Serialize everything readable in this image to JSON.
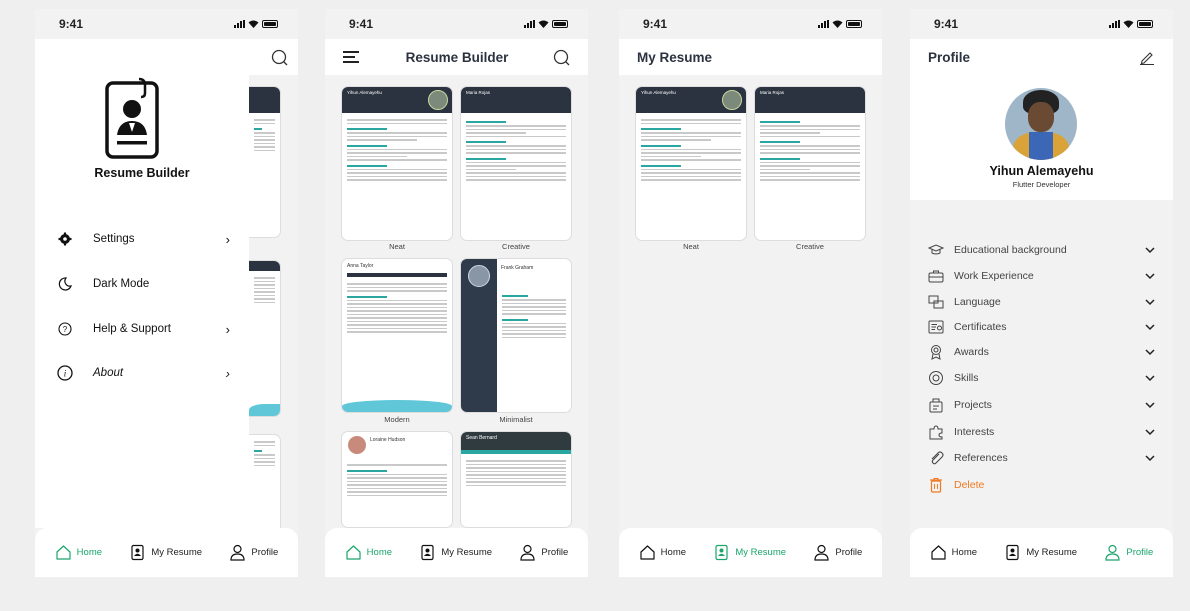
{
  "status": {
    "time": "9:41"
  },
  "colors": {
    "accent": "#1aa56b",
    "delete": "#f07a22",
    "cv_dark": "#2c3340"
  },
  "drawer": {
    "app_title": "Resume Builder",
    "items": [
      {
        "label": "Settings",
        "icon": "gear-icon",
        "has_chevron": true
      },
      {
        "label": "Dark Mode",
        "icon": "moon-icon",
        "has_chevron": false
      },
      {
        "label": "Help & Support",
        "icon": "help-icon",
        "has_chevron": true
      },
      {
        "label": "About",
        "icon": "info-icon",
        "has_chevron": true
      }
    ]
  },
  "builder": {
    "title": "Resume Builder",
    "templates": [
      {
        "label": "Neat"
      },
      {
        "label": "Creative"
      },
      {
        "label": "Modern"
      },
      {
        "label": "Minimalist"
      }
    ],
    "cv_names": [
      "Yihun Alemayehu",
      "Maria Rojas",
      "Anna Taylor",
      "Frank Graham",
      "Loraine Hudson",
      "Sean Bernard"
    ]
  },
  "my_resume": {
    "title": "My Resume",
    "items": [
      {
        "label": "Neat"
      },
      {
        "label": "Creative"
      }
    ]
  },
  "profile": {
    "title": "Profile",
    "name": "Yihun Alemayehu",
    "role": "Flutter Developer",
    "sections": [
      {
        "label": "Educational background",
        "icon": "graduation-cap-icon"
      },
      {
        "label": "Work Experience",
        "icon": "briefcase-icon"
      },
      {
        "label": "Language",
        "icon": "language-icon"
      },
      {
        "label": "Certificates",
        "icon": "certificate-icon"
      },
      {
        "label": "Awards",
        "icon": "award-icon"
      },
      {
        "label": "Skills",
        "icon": "skills-icon"
      },
      {
        "label": "Projects",
        "icon": "projects-icon"
      },
      {
        "label": "Interests",
        "icon": "puzzle-icon"
      },
      {
        "label": "References",
        "icon": "paperclip-icon"
      }
    ],
    "delete_label": "Delete"
  },
  "tabs": [
    {
      "label": "Home",
      "icon": "home-icon"
    },
    {
      "label": "My Resume",
      "icon": "resume-icon"
    },
    {
      "label": "Profile",
      "icon": "user-icon"
    }
  ]
}
